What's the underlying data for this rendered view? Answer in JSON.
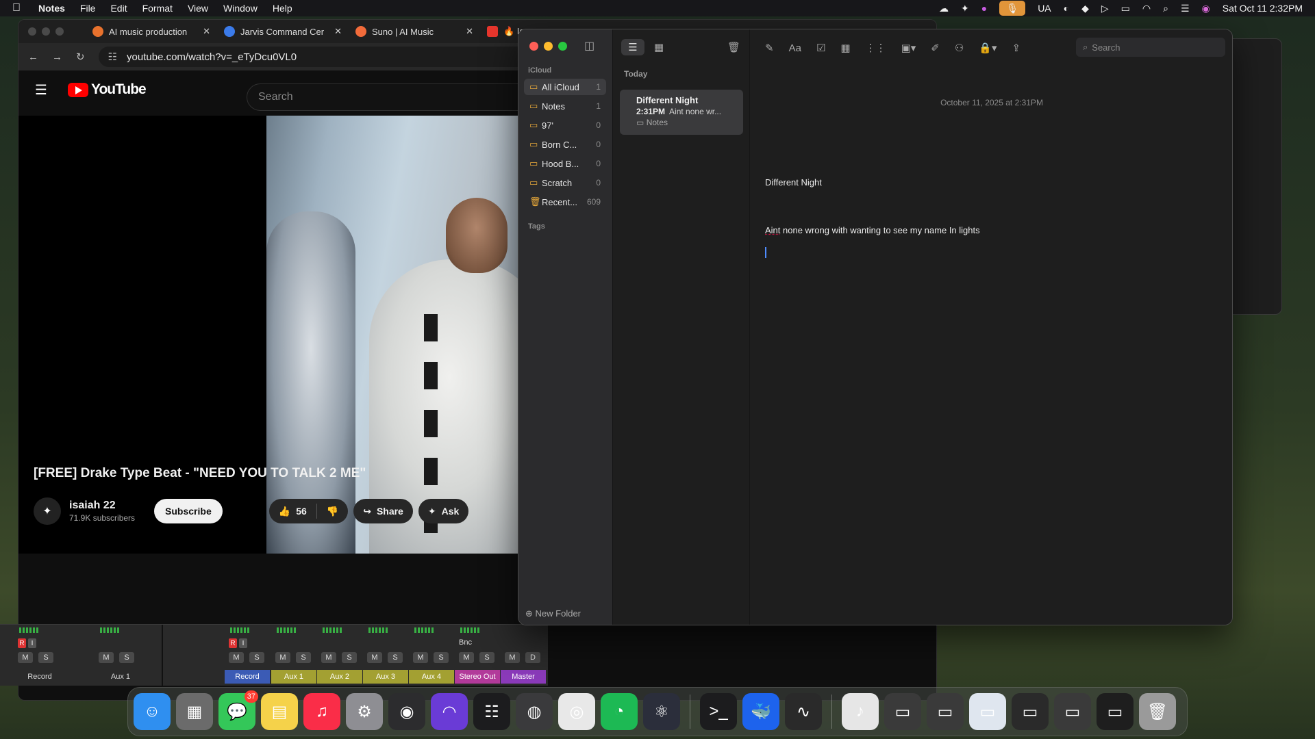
{
  "menubar": {
    "app_name": "Notes",
    "menus": [
      "File",
      "Edit",
      "Format",
      "View",
      "Window",
      "Help"
    ],
    "status_ua": "UA",
    "datetime": "Sat Oct 11  2:32PM"
  },
  "browser": {
    "tabs": [
      {
        "label": "AI music production",
        "color": "#e8722d"
      },
      {
        "label": "Jarvis Command Cer",
        "color": "#3b7bea"
      },
      {
        "label": "Suno | AI Music",
        "color": "#f26b3a"
      },
      {
        "label": "🔥 Ice",
        "color": "#e8362d"
      }
    ],
    "url": "youtube.com/watch?v=_eTyDcu0VL0"
  },
  "youtube": {
    "logo": "YouTube",
    "search_placeholder": "Search",
    "video_title": "[FREE] Drake Type Beat - \"NEED YOU TO TALK 2 ME\"",
    "channel_name": "isaiah 22",
    "subscribers": "71.9K subscribers",
    "subscribe_label": "Subscribe",
    "likes": "56",
    "share_label": "Share",
    "ask_label": "Ask"
  },
  "mixer": {
    "record_flags": [
      "R",
      "I"
    ],
    "bnc_label": "Bnc",
    "channels": [
      {
        "label": "Record",
        "color": "#2a2a2a",
        "text_color": "#ddd",
        "buttons": [
          "M",
          "S"
        ]
      },
      {
        "label": "Aux 1",
        "color": "#2a2a2a",
        "text_color": "#ddd",
        "buttons": [
          "M",
          "S"
        ]
      },
      {
        "label": "Record",
        "color": "#3b5bb5",
        "text_color": "#fff",
        "buttons": [
          "M",
          "S"
        ]
      },
      {
        "label": "Aux 1",
        "color": "#a3a032",
        "text_color": "#fff",
        "buttons": [
          "M",
          "S"
        ]
      },
      {
        "label": "Aux 2",
        "color": "#a3a032",
        "text_color": "#fff",
        "buttons": [
          "M",
          "S"
        ]
      },
      {
        "label": "Aux 3",
        "color": "#a3a032",
        "text_color": "#fff",
        "buttons": [
          "M",
          "S"
        ]
      },
      {
        "label": "Aux 4",
        "color": "#a3a032",
        "text_color": "#fff",
        "buttons": [
          "M",
          "S"
        ]
      },
      {
        "label": "Stereo Out",
        "color": "#b23a9a",
        "text_color": "#fff",
        "buttons": [
          "M",
          "S"
        ]
      },
      {
        "label": "Master",
        "color": "#8a3ab9",
        "text_color": "#fff",
        "buttons": [
          "M",
          "D"
        ]
      }
    ]
  },
  "notes": {
    "section_icloud": "iCloud",
    "folders": [
      {
        "name": "All iCloud",
        "count": "1",
        "selected": true
      },
      {
        "name": "Notes",
        "count": "1",
        "selected": false
      },
      {
        "name": "97'",
        "count": "0",
        "selected": false
      },
      {
        "name": "Born C...",
        "count": "0",
        "selected": false
      },
      {
        "name": "Hood B...",
        "count": "0",
        "selected": false
      },
      {
        "name": "Scratch",
        "count": "0",
        "selected": false
      },
      {
        "name": "Recent...",
        "count": "609",
        "selected": false
      }
    ],
    "section_tags": "Tags",
    "new_folder": "New Folder",
    "list_header": "Today",
    "note": {
      "title": "Different Night",
      "time": "2:31PM",
      "preview": "Aint none wr...",
      "folder": "Notes"
    },
    "editor": {
      "search_placeholder": "Search",
      "date": "October 11, 2025 at 2:31PM",
      "title": "Different Night",
      "misspelled_word": "Aint",
      "body_rest": " none wrong with wanting to see my name In lights"
    }
  },
  "dock": {
    "messages_badge": "37",
    "apps": [
      {
        "name": "finder-icon",
        "glyph": "☺",
        "color": "#2f8ff0"
      },
      {
        "name": "launchpad-icon",
        "glyph": "▦",
        "color": "#6b6b6b"
      },
      {
        "name": "messages-icon",
        "glyph": "💬",
        "color": "#34c759",
        "badge": true
      },
      {
        "name": "notes-icon",
        "glyph": "▤",
        "color": "#f5d24a"
      },
      {
        "name": "music-icon",
        "glyph": "♫",
        "color": "#fa2d48"
      },
      {
        "name": "system-settings-icon",
        "glyph": "⚙",
        "color": "#8e8e93"
      },
      {
        "name": "ua-console-icon",
        "glyph": "◉",
        "color": "#2c2c2e"
      },
      {
        "name": "luna-icon",
        "glyph": "◠",
        "color": "#6a3bd6"
      },
      {
        "name": "mixer-icon",
        "glyph": "☷",
        "color": "#1c1c1e"
      },
      {
        "name": "logic-icon",
        "glyph": "◍",
        "color": "#3a3a3c"
      },
      {
        "name": "chrome-icon",
        "glyph": "◎",
        "color": "#e8e8e8"
      },
      {
        "name": "spotify-icon",
        "glyph": "◔",
        "color": "#1db954"
      },
      {
        "name": "electron-icon",
        "glyph": "⚛",
        "color": "#2b2e3b"
      },
      {
        "name": "terminal-icon",
        "glyph": ">_",
        "color": "#1c1c1e"
      },
      {
        "name": "docker-icon",
        "glyph": "🐳",
        "color": "#1d63ed"
      },
      {
        "name": "audio-editor-icon",
        "glyph": "∿",
        "color": "#2a2a2a"
      },
      {
        "name": "music-file-icon",
        "glyph": "♪",
        "color": "#e6e6e6"
      },
      {
        "name": "window-thumb-icon",
        "glyph": "▭",
        "color": "#3a3a3a"
      },
      {
        "name": "window-thumb-icon",
        "glyph": "▭",
        "color": "#3a3a3a"
      },
      {
        "name": "window-thumb-icon",
        "glyph": "▭",
        "color": "#dfe6ef"
      },
      {
        "name": "window-thumb-icon",
        "glyph": "▭",
        "color": "#2a2a2a"
      },
      {
        "name": "window-thumb-icon",
        "glyph": "▭",
        "color": "#3a3a3a"
      },
      {
        "name": "window-thumb-icon",
        "glyph": "▭",
        "color": "#1e1e1e"
      },
      {
        "name": "trash-icon",
        "glyph": "🗑",
        "color": "#9a9a9a"
      }
    ]
  }
}
